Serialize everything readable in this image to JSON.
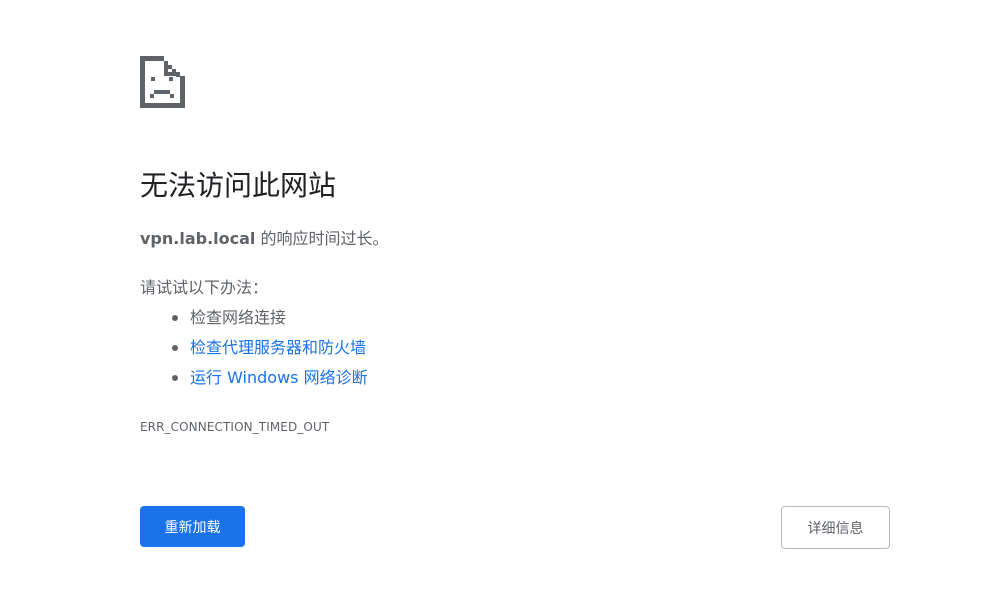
{
  "error_page": {
    "icon": "sad-page-icon",
    "title": "无法访问此网站",
    "summary": {
      "host": "vpn.lab.local",
      "message": " 的响应时间过长。"
    },
    "try_label": "请试试以下办法：",
    "suggestions": [
      {
        "label": "检查网络连接",
        "is_link": false
      },
      {
        "label": "检查代理服务器和防火墙",
        "is_link": true
      },
      {
        "label": "运行 Windows 网络诊断",
        "is_link": true
      }
    ],
    "error_code": "ERR_CONNECTION_TIMED_OUT",
    "buttons": {
      "reload": "重新加载",
      "details": "详细信息"
    }
  },
  "colors": {
    "accent": "#1a73e8",
    "text": "#5f6368",
    "title": "#202124",
    "icon": "#5f6368"
  }
}
